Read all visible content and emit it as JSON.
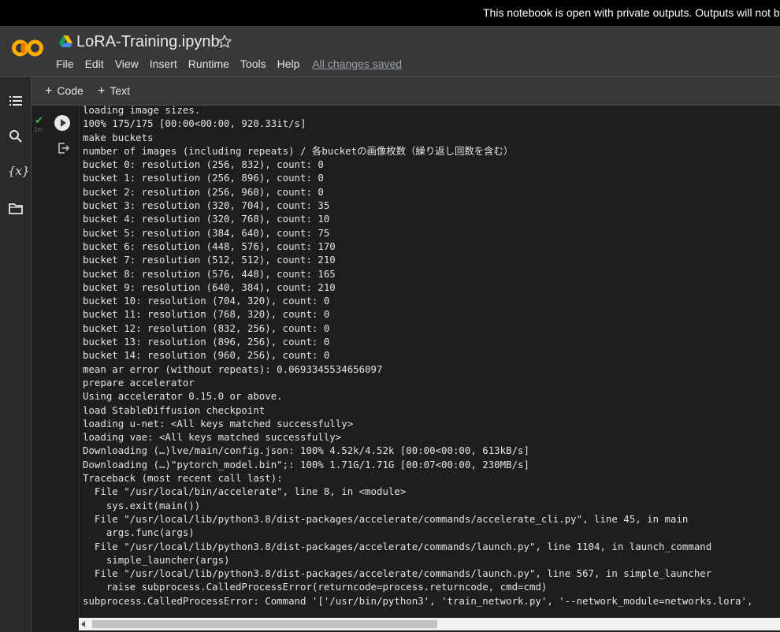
{
  "banner": {
    "text": "This notebook is open with private outputs. Outputs will not b"
  },
  "header": {
    "notebook_title": "LoRA-Training.ipynb",
    "menu": [
      "File",
      "Edit",
      "View",
      "Insert",
      "Runtime",
      "Tools",
      "Help"
    ],
    "save_status": "All changes saved"
  },
  "rail": {
    "variables_label": "{x}"
  },
  "toolbar": {
    "code_label": "Code",
    "text_label": "Text",
    "plus": "+"
  },
  "cell": {
    "status": "success",
    "runtime": "1m",
    "output_lines": [
      "loading image sizes.",
      "100% 175/175 [00:00<00:00, 920.33it/s]",
      "make buckets",
      "number of images (including repeats) / 各bucketの画像枚数（繰り返し回数を含む）",
      "bucket 0: resolution (256, 832), count: 0",
      "bucket 1: resolution (256, 896), count: 0",
      "bucket 2: resolution (256, 960), count: 0",
      "bucket 3: resolution (320, 704), count: 35",
      "bucket 4: resolution (320, 768), count: 10",
      "bucket 5: resolution (384, 640), count: 75",
      "bucket 6: resolution (448, 576), count: 170",
      "bucket 7: resolution (512, 512), count: 210",
      "bucket 8: resolution (576, 448), count: 165",
      "bucket 9: resolution (640, 384), count: 210",
      "bucket 10: resolution (704, 320), count: 0",
      "bucket 11: resolution (768, 320), count: 0",
      "bucket 12: resolution (832, 256), count: 0",
      "bucket 13: resolution (896, 256), count: 0",
      "bucket 14: resolution (960, 256), count: 0",
      "mean ar error (without repeats): 0.0693345534656097",
      "prepare accelerator",
      "Using accelerator 0.15.0 or above.",
      "load StableDiffusion checkpoint",
      "loading u-net: <All keys matched successfully>",
      "loading vae: <All keys matched successfully>",
      "Downloading (…)lve/main/config.json: 100% 4.52k/4.52k [00:00<00:00, 613kB/s]",
      "Downloading (…)\"pytorch_model.bin\";: 100% 1.71G/1.71G [00:07<00:00, 230MB/s]",
      "Traceback (most recent call last):",
      "  File \"/usr/local/bin/accelerate\", line 8, in <module>",
      "    sys.exit(main())",
      "  File \"/usr/local/lib/python3.8/dist-packages/accelerate/commands/accelerate_cli.py\", line 45, in main",
      "    args.func(args)",
      "  File \"/usr/local/lib/python3.8/dist-packages/accelerate/commands/launch.py\", line 1104, in launch_command",
      "    simple_launcher(args)",
      "  File \"/usr/local/lib/python3.8/dist-packages/accelerate/commands/launch.py\", line 567, in simple_launcher",
      "    raise subprocess.CalledProcessError(returncode=process.returncode, cmd=cmd)",
      "subprocess.CalledProcessError: Command '['/usr/bin/python3', 'train_network.py', '--network_module=networks.lora',"
    ]
  },
  "colors": {
    "background": "#1e1e1e",
    "header": "#383838",
    "logo_orange": "#f9ab00",
    "logo_dark_orange": "#e37400",
    "success_check": "#4caf50"
  },
  "icons": [
    "colab-logo",
    "drive-icon",
    "star-icon",
    "toc-icon",
    "search-icon",
    "variables-icon",
    "folder-icon",
    "run-icon",
    "output-redirect-icon"
  ]
}
